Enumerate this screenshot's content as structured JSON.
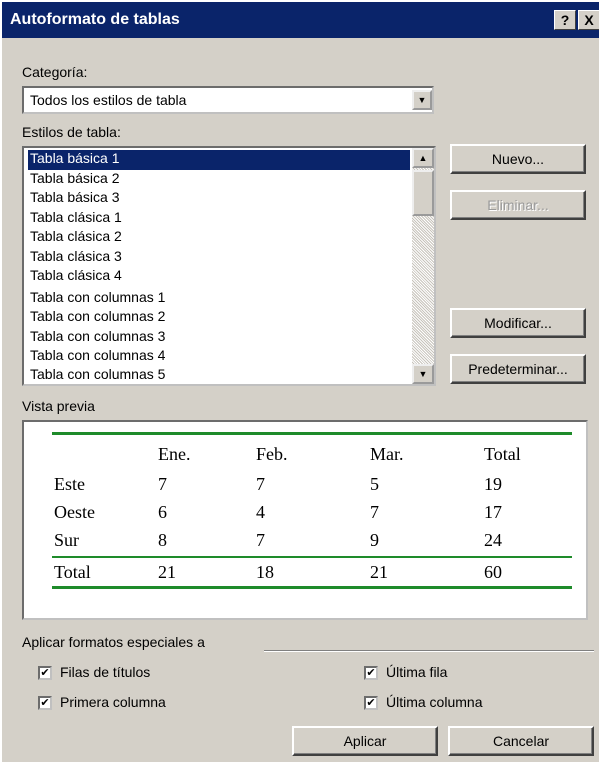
{
  "window": {
    "title": "Autoformato de tablas",
    "help_button": "?",
    "close_button": "X"
  },
  "category": {
    "label": "Categoría:",
    "value": "Todos los estilos de tabla"
  },
  "styles": {
    "label": "Estilos de tabla:",
    "items": [
      "Tabla básica 1",
      "Tabla básica 2",
      "Tabla básica 3",
      "Tabla clásica 1",
      "Tabla clásica 2",
      "Tabla clásica 3",
      "Tabla clásica 4",
      "Tabla con columnas 1",
      "Tabla con columnas 2",
      "Tabla con columnas 3",
      "Tabla con columnas 4",
      "Tabla con columnas 5"
    ],
    "selected": "Tabla básica 1"
  },
  "buttons": {
    "new": "Nuevo...",
    "delete": "Eliminar...",
    "modify": "Modificar...",
    "default": "Predeterminar...",
    "apply": "Aplicar",
    "cancel": "Cancelar"
  },
  "preview": {
    "label": "Vista previa",
    "header": [
      "",
      "Ene.",
      "Feb.",
      "Mar.",
      "Total"
    ],
    "rows": [
      [
        "Este",
        "7",
        "7",
        "5",
        "19"
      ],
      [
        "Oeste",
        "6",
        "4",
        "7",
        "17"
      ],
      [
        "Sur",
        "8",
        "7",
        "9",
        "24"
      ],
      [
        "Total",
        "21",
        "18",
        "21",
        "60"
      ]
    ]
  },
  "special_formats": {
    "label": "Aplicar formatos especiales a",
    "heading_rows": {
      "label": "Filas de títulos",
      "checked": true
    },
    "first_column": {
      "label": "Primera columna",
      "checked": true
    },
    "last_row": {
      "label": "Última fila",
      "checked": true
    },
    "last_column": {
      "label": "Última columna",
      "checked": true
    }
  },
  "colors": {
    "title_bar": "#0a246a",
    "dialog_face": "#d4d0c8",
    "preview_rule": "#1e8b2a"
  }
}
